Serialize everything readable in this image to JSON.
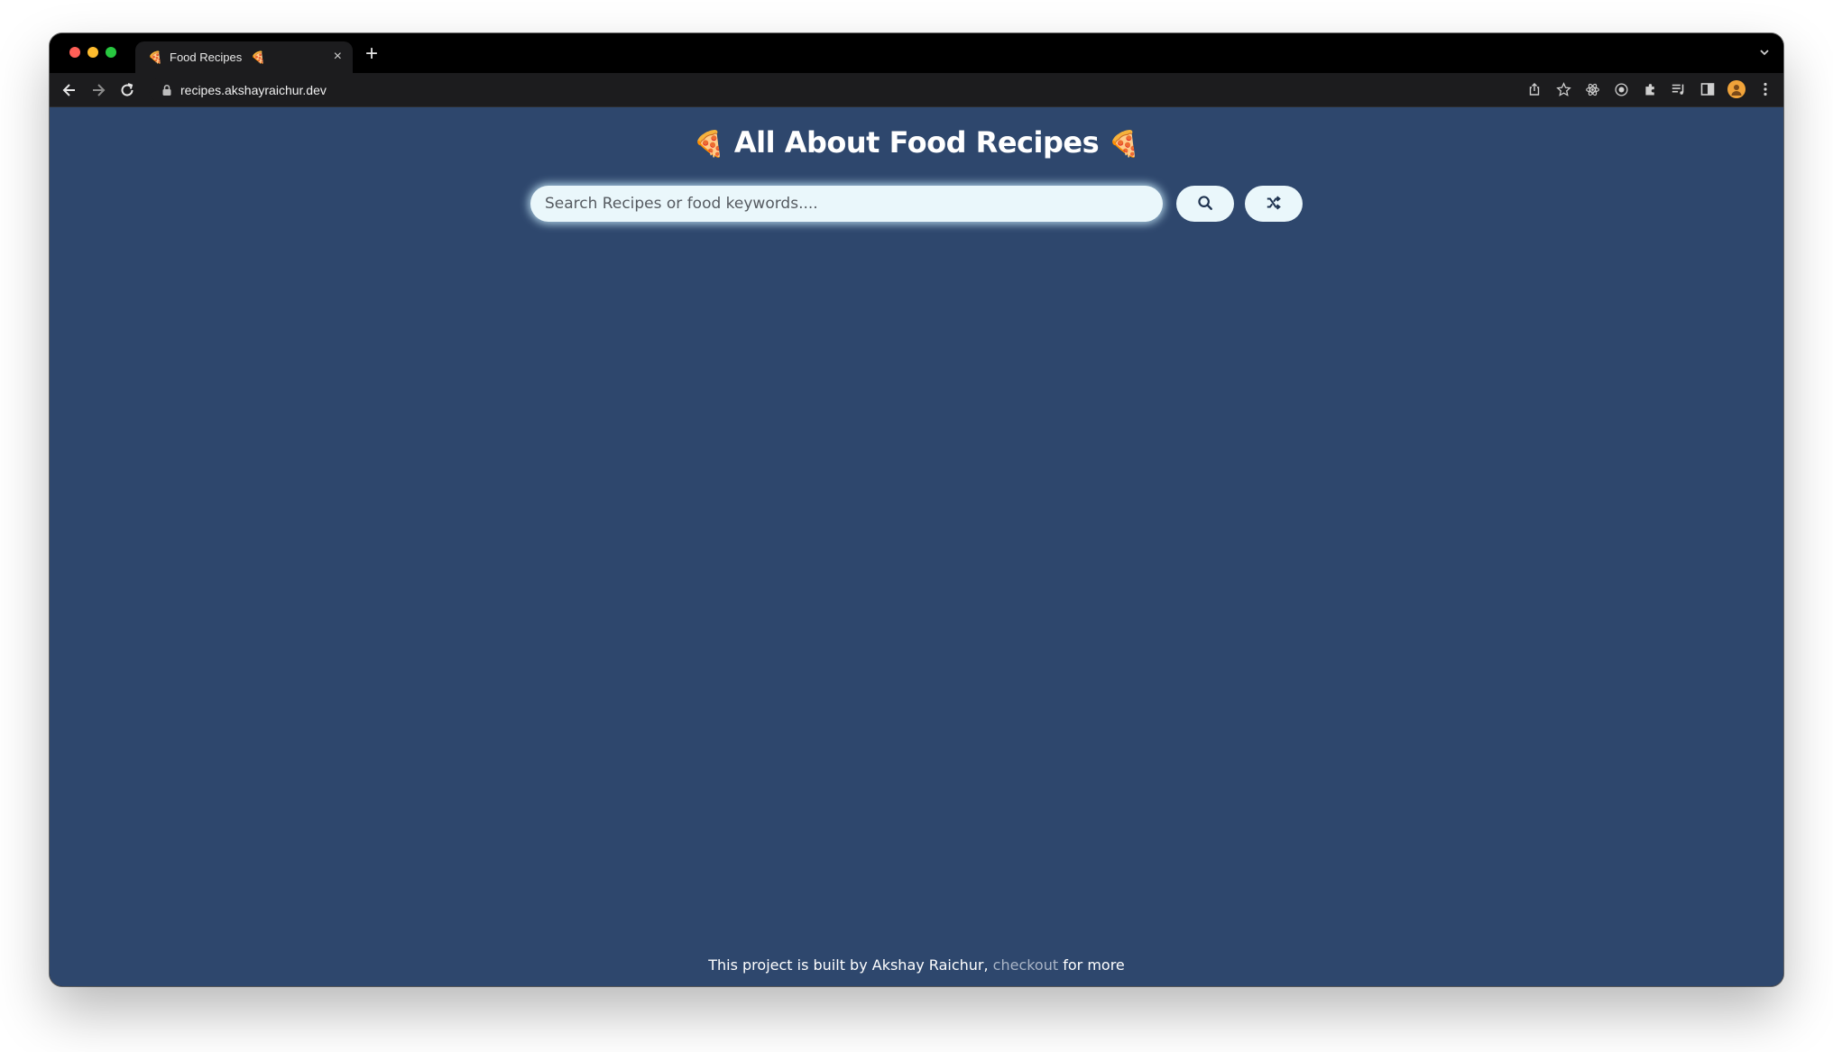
{
  "browser": {
    "tab_title": "Food Recipes",
    "tab_favicon": "🍕",
    "tab_audio_icon": "🍕",
    "close_glyph": "×",
    "new_tab_glyph": "+",
    "url": "recipes.akshayraichur.dev"
  },
  "page": {
    "heading": "All About Food Recipes",
    "heading_emoji_left": "🍕",
    "heading_emoji_right": "🍕",
    "search_placeholder": "Search Recipes or food keywords....",
    "search_value": "",
    "footer_prefix": "This project is built by Akshay Raichur, ",
    "footer_link": "checkout",
    "footer_suffix": " for more"
  },
  "colors": {
    "page_background": "#2e476d",
    "button_background": "#eaf7fb",
    "link": "#a9b4c6"
  },
  "icons": {
    "search_button": "search-icon",
    "random_button": "shuffle-icon"
  }
}
